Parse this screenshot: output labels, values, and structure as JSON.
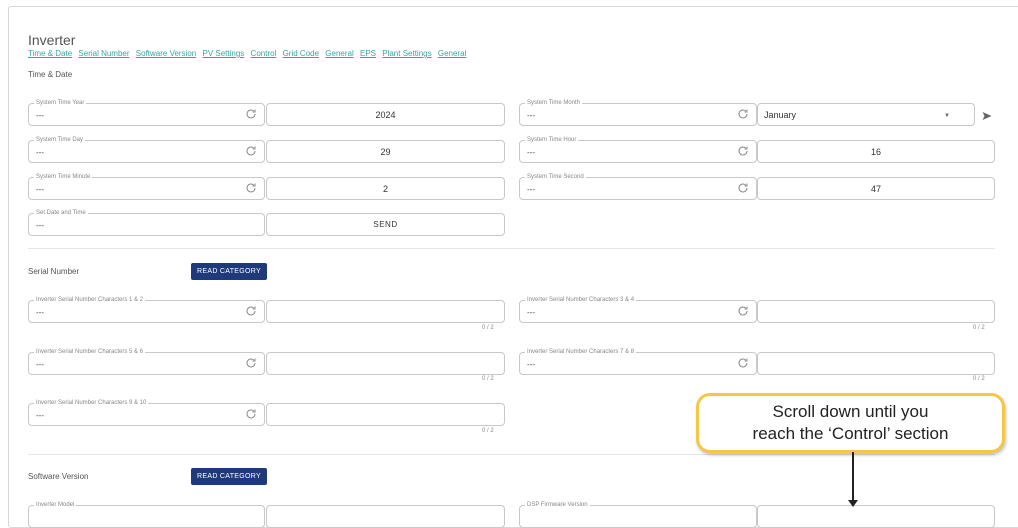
{
  "page": {
    "title": "Inverter"
  },
  "nav_links": [
    "Time & Date",
    "Serial Number",
    "Software Version",
    "PV Settings",
    "Control",
    "Grid Code",
    "General",
    "EPS",
    "Plant Settings",
    "General"
  ],
  "time_date": {
    "heading": "Time & Date",
    "year": {
      "label": "System Time Year",
      "current": "---",
      "value": "2024"
    },
    "month": {
      "label": "System Time Month",
      "current": "---",
      "value": "January"
    },
    "day": {
      "label": "System Time Day",
      "current": "---",
      "value": "29"
    },
    "hour": {
      "label": "System Time Hour",
      "current": "---",
      "value": "16"
    },
    "minute": {
      "label": "System Time Minute",
      "current": "---",
      "value": "2"
    },
    "second": {
      "label": "System Time Second",
      "current": "---",
      "value": "47"
    },
    "set": {
      "label": "Set Date and Time",
      "current": "---",
      "send_label": "SEND"
    }
  },
  "serial_number": {
    "heading": "Serial Number",
    "read_label": "READ CATEGORY",
    "counter": "0 / 2",
    "f12": {
      "label": "Inverter Serial Number Characters 1 & 2",
      "current": "---"
    },
    "f34": {
      "label": "Inverter Serial Number Characters 3 & 4",
      "current": "---"
    },
    "f56": {
      "label": "Inverter Serial Number Characters 5 & 6",
      "current": "---"
    },
    "f78": {
      "label": "Inverter Serial Number Characters 7 & 8",
      "current": "---"
    },
    "f910": {
      "label": "Inverter Serial Number Characters 9 & 10",
      "current": "---"
    }
  },
  "software_version": {
    "heading": "Software Version",
    "read_label": "READ CATEGORY",
    "model": {
      "label": "Inverter Model"
    },
    "dsp": {
      "label": "DSP Firmware Version"
    }
  },
  "callout": {
    "line1": "Scroll down until you",
    "line2": "reach the ‘Control’ section"
  },
  "icons": {
    "refresh": "refresh-icon",
    "send": "send-arrow-icon",
    "dropdown": "caret-down-icon"
  },
  "colors": {
    "accent_link": "#3aa5a0",
    "button": "#1f3a7a",
    "callout_border": "#f3c846"
  }
}
